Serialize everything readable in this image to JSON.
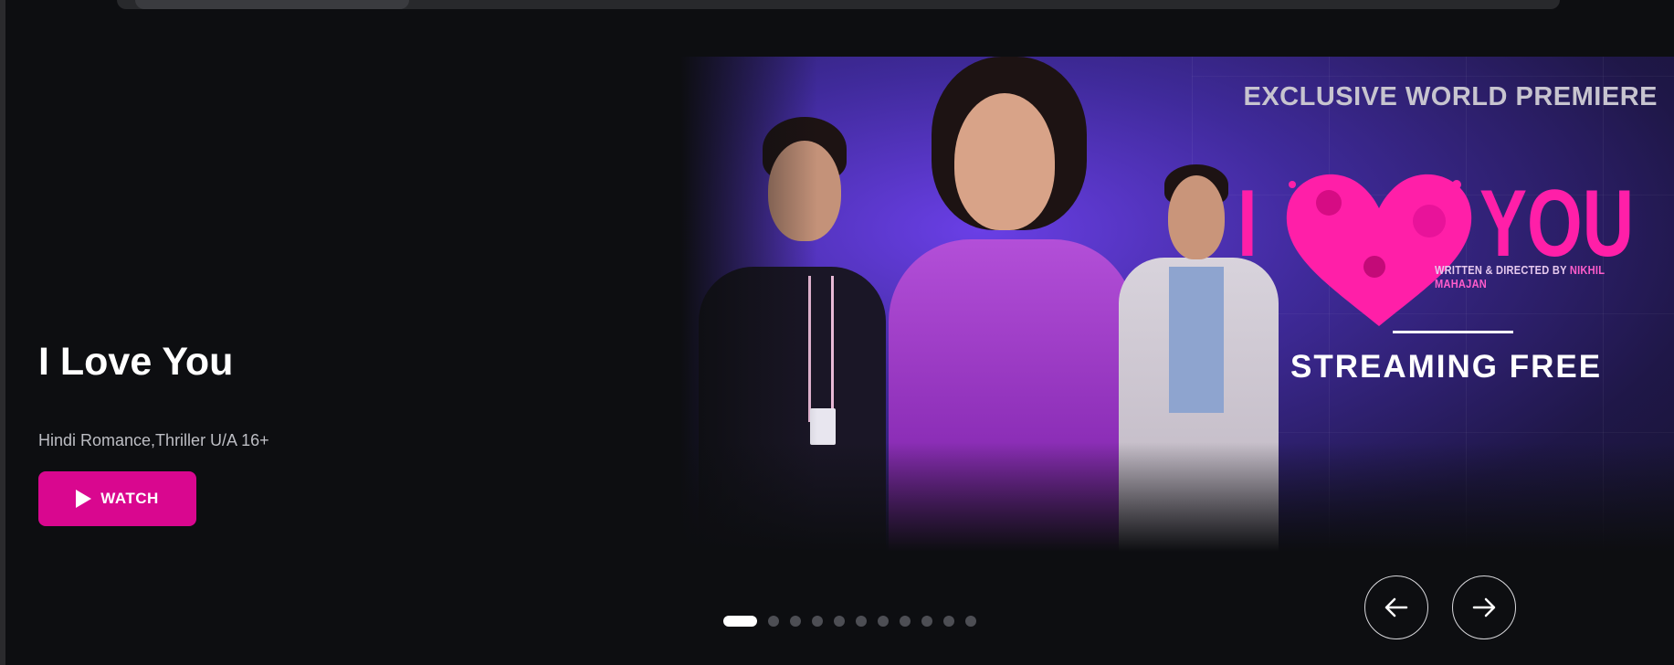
{
  "hero": {
    "title": "I Love You",
    "meta": "Hindi Romance,Thriller U/A 16+",
    "watch_label": "WATCH",
    "poster": {
      "exclusive": "EXCLUSIVE WORLD PREMIERE",
      "title_left": "I",
      "title_right": "YOU",
      "credit_prefix": "WRITTEN & DIRECTED BY",
      "credit_name": "NIKHIL MAHAJAN",
      "streaming": "STREAMING FREE"
    }
  },
  "carousel": {
    "total_slides": 11,
    "active_index": 0
  },
  "icons": {
    "play": "play-icon",
    "prev": "arrow-left-icon",
    "next": "arrow-right-icon"
  },
  "colors": {
    "accent": "#d9078f",
    "background": "#0d0e11",
    "poster_pink": "#ff1fa8"
  }
}
